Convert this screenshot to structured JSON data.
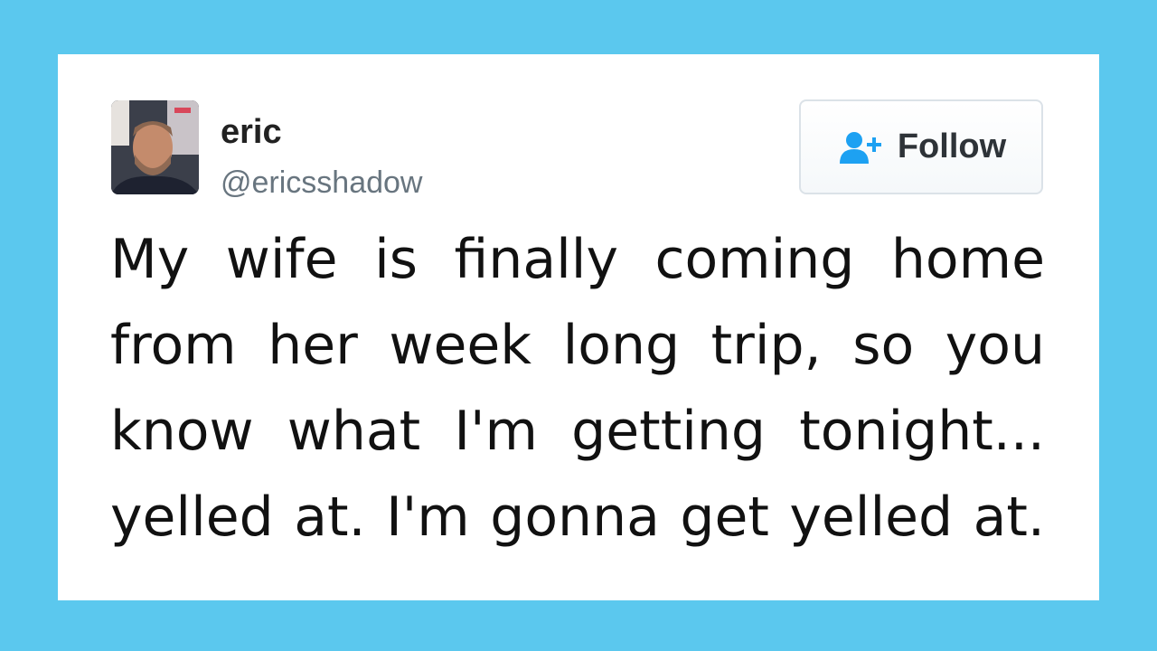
{
  "tweet": {
    "author": {
      "display_name": "eric",
      "handle": "@ericsshadow",
      "avatar_icon": "profile-photo"
    },
    "follow_button": {
      "label": "Follow",
      "icon": "add-user-icon",
      "icon_color": "#1da1f2"
    },
    "text": "My wife is finally coming home from her week long trip, so you know what I'm getting tonight... yelled at. I'm gonna get yelled at."
  },
  "colors": {
    "background": "#5bc8ee",
    "card": "#ffffff"
  }
}
